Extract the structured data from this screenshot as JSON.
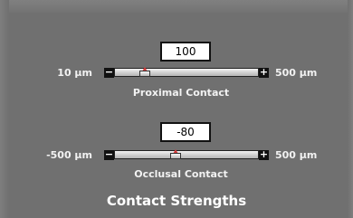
{
  "proximal": {
    "value": "100",
    "min_label": "10 µm",
    "max_label": "500 µm",
    "title": "Proximal Contact",
    "level_fraction": 0.184,
    "decrement_glyph": "−",
    "increment_glyph": "+"
  },
  "occlusal": {
    "value": "-80",
    "min_label": "-500 µm",
    "max_label": "500 µm",
    "title": "Occlusal Contact",
    "level_fraction": 0.42,
    "decrement_glyph": "−",
    "increment_glyph": "+"
  },
  "section_title": "Contact Strengths",
  "colors": {
    "panel_background": "#707070",
    "thumb_tip": "#d33a3a",
    "label_text": "#f2f2f2"
  }
}
